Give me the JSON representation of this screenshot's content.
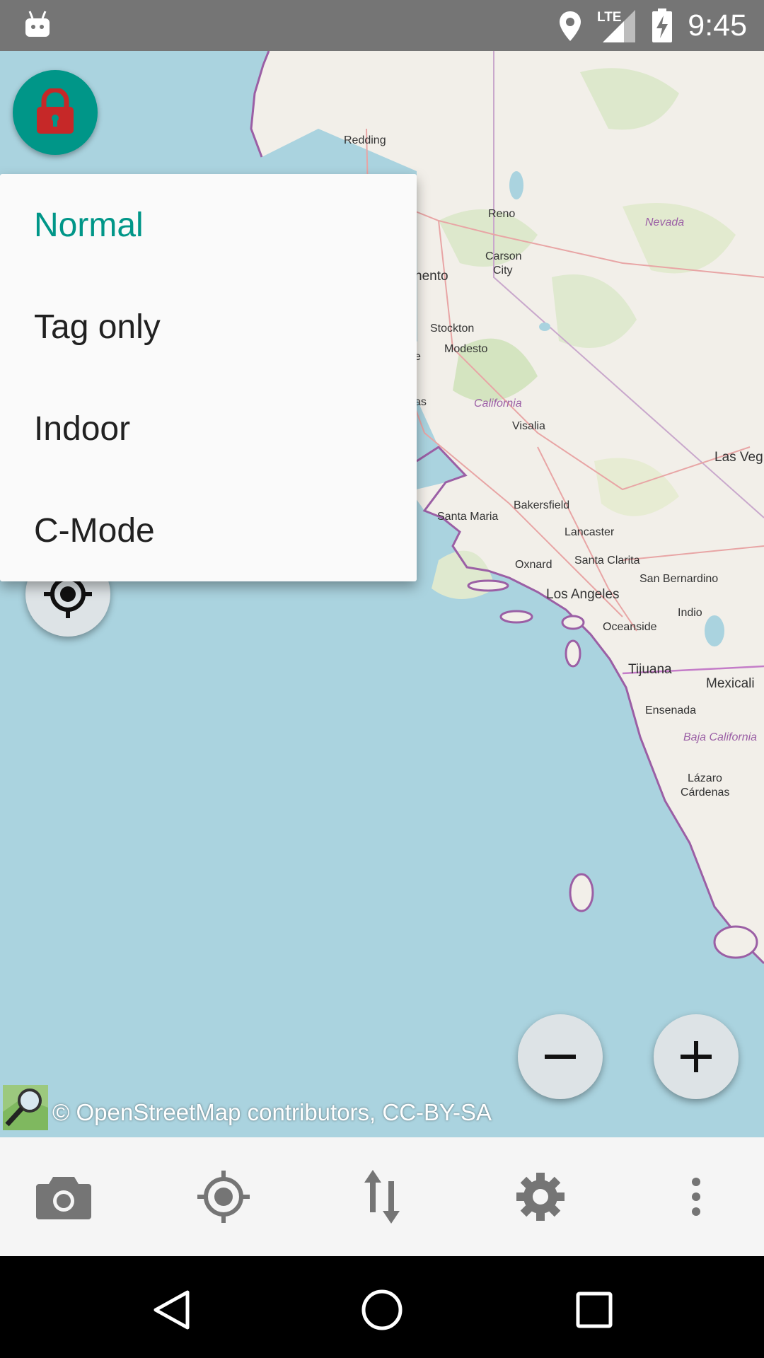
{
  "status_bar": {
    "time": "9:45",
    "network": "LTE",
    "icons": [
      "android-icon",
      "location-icon",
      "signal-icon",
      "battery-charging-icon"
    ]
  },
  "map": {
    "labels": {
      "redding": "Redding",
      "reno": "Reno",
      "nevada": "Nevada",
      "carson_city_1": "Carson",
      "carson_city_2": "City",
      "sacramento": "nento",
      "stockton": "Stockton",
      "modesto": "Modesto",
      "e_frag": "e",
      "as_frag": "as",
      "california": "California",
      "visalia": "Visalia",
      "las_vegas": "Las Veg",
      "bakersfield": "Bakersfield",
      "santa_maria": "Santa Maria",
      "lancaster": "Lancaster",
      "oxnard": "Oxnard",
      "santa_clarita": "Santa Clarita",
      "san_bernardino": "San Bernardino",
      "los_angeles": "Los Angeles",
      "indio": "Indio",
      "oceanside": "Oceanside",
      "tijuana": "Tijuana",
      "mexicali": "Mexicali",
      "ensenada": "Ensenada",
      "baja_california": "Baja California",
      "lazaro_1": "Lázaro",
      "lazaro_2": "Cárdenas"
    },
    "attribution": "© OpenStreetMap contributors, CC-BY-SA"
  },
  "lock_button": {
    "icon": "lock-icon",
    "color": "#009688",
    "lock_color": "#c62828"
  },
  "mode_menu": {
    "items": [
      {
        "label": "Normal",
        "selected": true
      },
      {
        "label": "Tag only",
        "selected": false
      },
      {
        "label": "Indoor",
        "selected": false
      },
      {
        "label": "C-Mode",
        "selected": false
      }
    ],
    "accent": "#009688"
  },
  "zoom": {
    "out_icon": "minus-icon",
    "in_icon": "plus-icon"
  },
  "toolbar": {
    "items": [
      "camera-icon",
      "gps-icon",
      "transfer-icon",
      "settings-icon",
      "more-icon"
    ]
  },
  "nav_bar": {
    "items": [
      "back-icon",
      "home-icon",
      "recents-icon"
    ]
  }
}
